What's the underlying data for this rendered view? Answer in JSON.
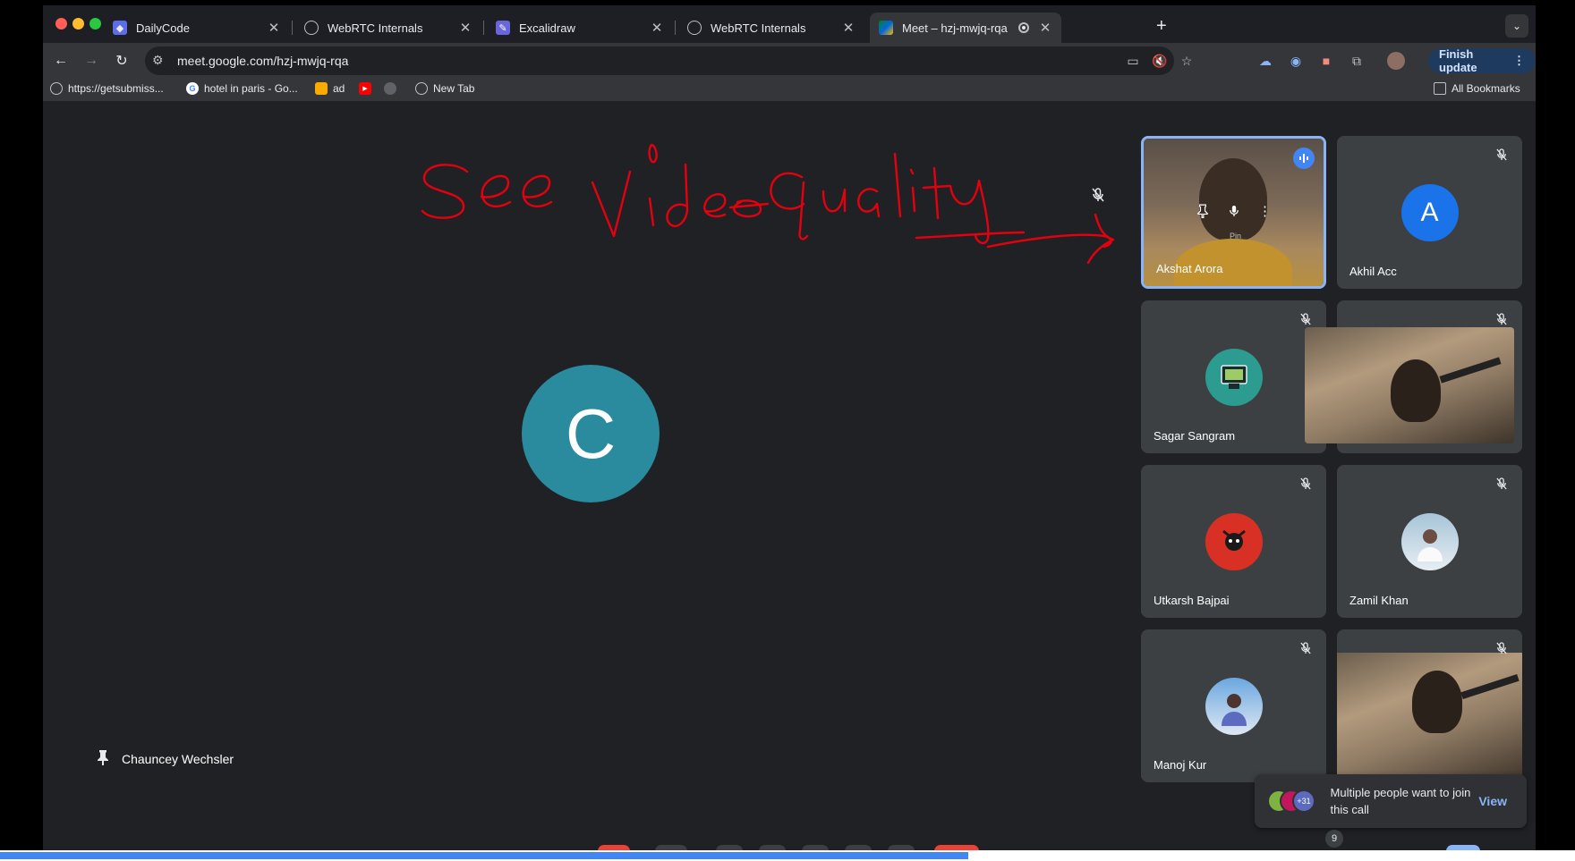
{
  "tabs": [
    {
      "title": "DailyCode",
      "favicon": "dailycode-icon",
      "active": false
    },
    {
      "title": "WebRTC Internals",
      "favicon": "globe-icon",
      "active": false
    },
    {
      "title": "Excalidraw",
      "favicon": "excalidraw-icon",
      "active": false
    },
    {
      "title": "WebRTC Internals",
      "favicon": "globe-icon",
      "active": false
    },
    {
      "title": "Meet – hzj-mwjq-rqa",
      "favicon": "meet-icon",
      "active": true
    }
  ],
  "toolbar": {
    "url": "meet.google.com/hzj-mwjq-rqa",
    "finish_update": "Finish update"
  },
  "bookmarks": [
    {
      "label": "https://getsubmiss...",
      "icon": "globe-icon"
    },
    {
      "label": "hotel in paris - Go...",
      "icon": "google-icon"
    },
    {
      "label": "ad",
      "icon": "hand-icon"
    },
    {
      "label": "",
      "icon": "youtube-icon"
    },
    {
      "label": "",
      "icon": "extension-icon"
    },
    {
      "label": "New Tab",
      "icon": "globe-icon"
    }
  ],
  "all_bookmarks": "All Bookmarks",
  "annotation": {
    "text": "See Video Quality",
    "color": "#e4000f"
  },
  "main": {
    "avatar_letter": "C",
    "avatar_color": "#2a8b9e",
    "name": "Chauncey Wechsler"
  },
  "participants": [
    {
      "name": "Akshat Arora",
      "kind": "video",
      "speaking": true
    },
    {
      "name": "Akhil Acc",
      "kind": "letter",
      "letter": "A",
      "color": "#1a73e8"
    },
    {
      "name": "Sagar Sangram",
      "kind": "image",
      "color": "#2b9c8f"
    },
    {
      "name": "",
      "kind": "video"
    },
    {
      "name": "Utkarsh Bajpai",
      "kind": "image",
      "color": "#d93025"
    },
    {
      "name": "Zamil Khan",
      "kind": "image",
      "color": "#c9dbe8"
    },
    {
      "name": "Manoj Kur",
      "kind": "image",
      "color": "#4a8fd4"
    },
    {
      "name": "",
      "kind": "video"
    }
  ],
  "hover_tooltip": "Pin",
  "join_toast": {
    "message": "Multiple people want to join this call",
    "badge": "+31",
    "action": "View"
  },
  "participants_count": "9",
  "playback_progress": 0.615,
  "colors": {
    "speaking_border": "#8ab4f8",
    "accent": "#4285f4",
    "background": "#202124",
    "tile": "#3c4043"
  }
}
